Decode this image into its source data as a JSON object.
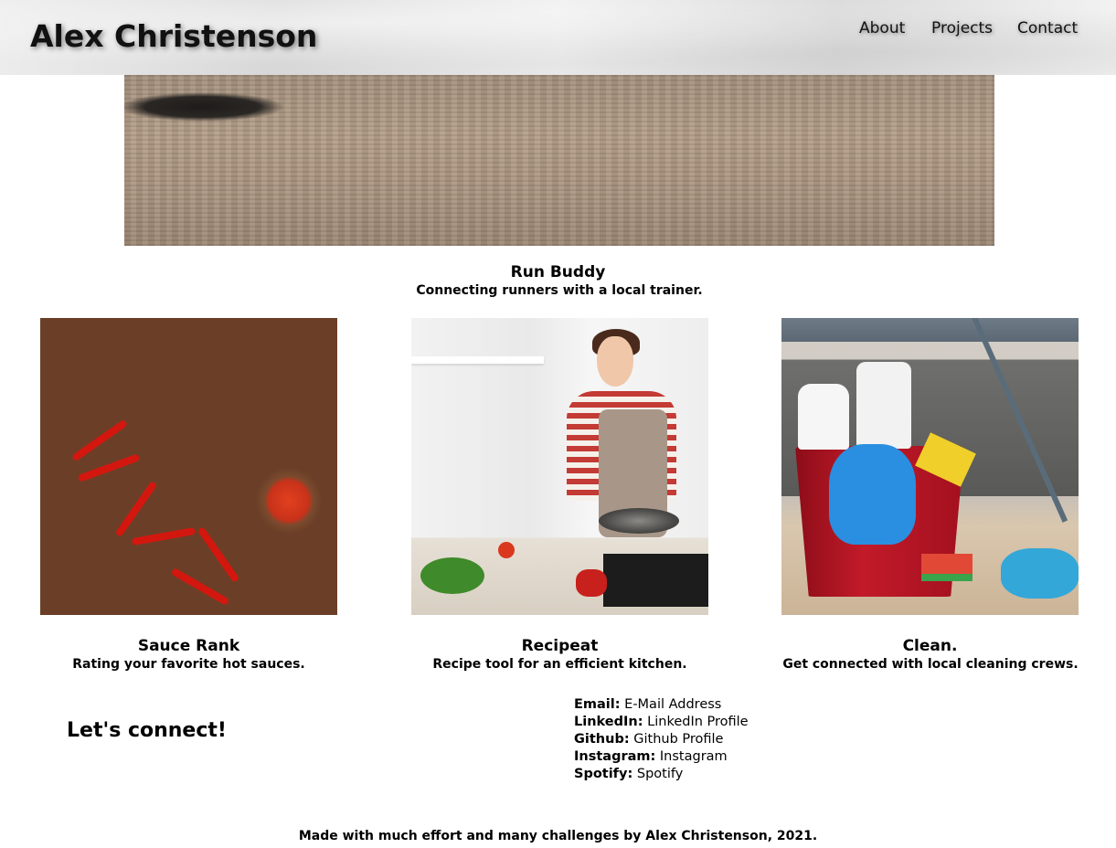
{
  "header": {
    "brand": "Alex Christenson",
    "nav": [
      "About",
      "Projects",
      "Contact"
    ]
  },
  "featured": {
    "title": "Run Buddy",
    "description": "Connecting runners with a local trainer."
  },
  "projects": [
    {
      "title": "Sauce Rank",
      "description": "Rating your favorite hot sauces."
    },
    {
      "title": "Recipeat",
      "description": "Recipe tool for an efficient kitchen."
    },
    {
      "title": "Clean.",
      "description": "Get connected with local cleaning crews."
    }
  ],
  "contact": {
    "heading": "Let's connect!",
    "items": [
      {
        "label": "Email:",
        "value": "E-Mail Address"
      },
      {
        "label": "LinkedIn:",
        "value": "LinkedIn Profile"
      },
      {
        "label": "Github:",
        "value": "Github Profile"
      },
      {
        "label": "Instagram:",
        "value": "Instagram"
      },
      {
        "label": "Spotify:",
        "value": "Spotify"
      }
    ]
  },
  "footer": {
    "text": "Made with much effort and many challenges by Alex Christenson, 2021."
  }
}
